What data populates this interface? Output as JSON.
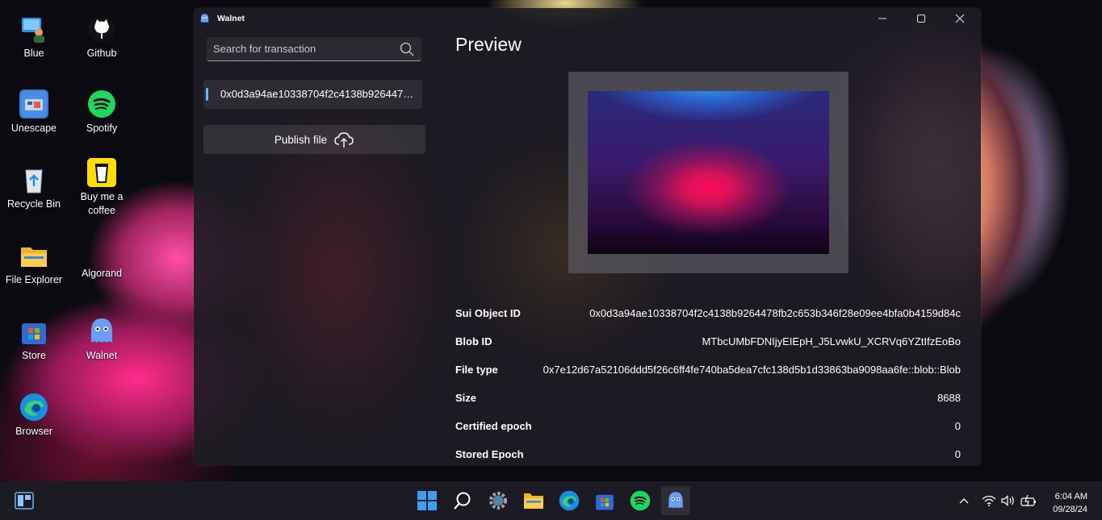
{
  "desktop": {
    "icons": [
      {
        "label": "Blue"
      },
      {
        "label": "Github"
      },
      {
        "label": "Unescape"
      },
      {
        "label": "Spotify"
      },
      {
        "label": "Recycle Bin"
      },
      {
        "label": "Buy me a coffee"
      },
      {
        "label": "File Explorer"
      },
      {
        "label": "Algorand"
      },
      {
        "label": "Store"
      },
      {
        "label": "Walnet"
      },
      {
        "label": "Browser"
      }
    ]
  },
  "window": {
    "title": "Walnet",
    "minimize": "—",
    "maximize": "☐",
    "close": "✕"
  },
  "sidebar": {
    "search_placeholder": "Search for transaction",
    "search_value": "",
    "transactions": [
      {
        "id": "0x0d3a94ae10338704f2c4138b9264478fb2c653b346f28e09ee4bfa0b4159d84c"
      }
    ],
    "publish_label": "Publish file"
  },
  "preview": {
    "title": "Preview",
    "details": [
      {
        "key": "Sui Object ID",
        "value": "0x0d3a94ae10338704f2c4138b9264478fb2c653b346f28e09ee4bfa0b4159d84c"
      },
      {
        "key": "Blob ID",
        "value": "MTbcUMbFDNIjyEIEpH_J5LvwkU_XCRVq6YZtIfzEoBo"
      },
      {
        "key": "File type",
        "value": "0x7e12d67a52106ddd5f26c6ff4fe740ba5dea7cfc138d5b1d33863ba9098aa6fe::blob::Blob"
      },
      {
        "key": "Size",
        "value": "8688"
      },
      {
        "key": "Certified epoch",
        "value": "0"
      },
      {
        "key": "Stored Epoch",
        "value": "0"
      }
    ]
  },
  "taskbar": {
    "time": "6:04 AM",
    "date": "09/28/24",
    "tray_overflow": "^"
  },
  "colors": {
    "accent": "#4cc2ff",
    "window_bg": "#1e1c24",
    "taskbar_bg": "#1c1a22"
  }
}
